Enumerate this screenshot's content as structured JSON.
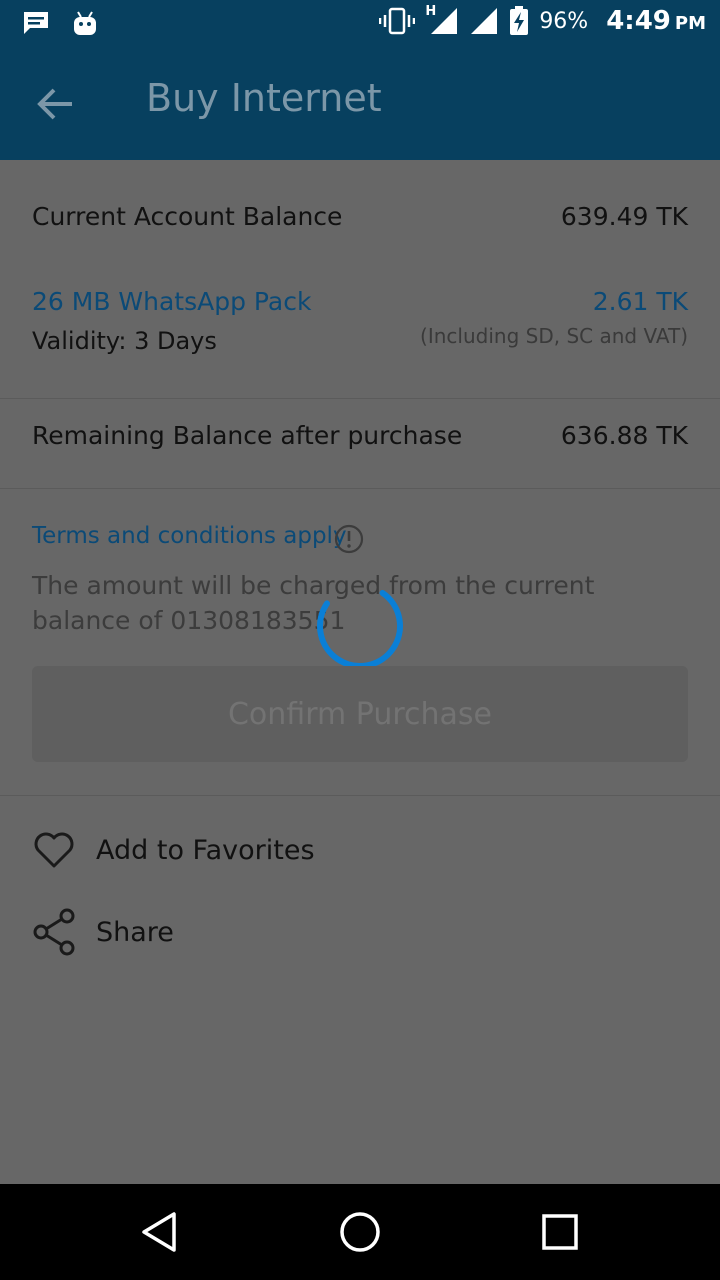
{
  "status_bar": {
    "battery_percent": "96%",
    "time": "4:49",
    "ampm": "PM",
    "network_label": "H",
    "icons": [
      "message-icon",
      "android-icon",
      "vibrate-icon",
      "signal-icon",
      "signal-icon",
      "battery-charging-icon"
    ]
  },
  "app_bar": {
    "title": "Buy Internet",
    "back_icon": "arrow-left-icon"
  },
  "balance": {
    "label": "Current Account Balance",
    "value": "639.49 TK"
  },
  "pack": {
    "name": "26 MB WhatsApp Pack",
    "validity": "Validity: 3 Days",
    "price": "2.61 TK",
    "price_note": "(Including SD, SC and VAT)"
  },
  "remaining": {
    "label": "Remaining Balance after purchase",
    "value": "636.88 TK"
  },
  "terms": {
    "label": "Terms and conditions apply",
    "description": "The amount will be charged from the current balance of 01308183551"
  },
  "confirm_button": {
    "label": "Confirm Purchase"
  },
  "loading": {
    "progress_fraction": 0.75
  },
  "actions": {
    "favorites_label": "Add to Favorites",
    "share_label": "Share"
  },
  "colors": {
    "app_bar": "#07405f",
    "accent_blue": "#0b4a77",
    "spinner": "#0a7fd6",
    "overlay_bg": "#676767"
  }
}
